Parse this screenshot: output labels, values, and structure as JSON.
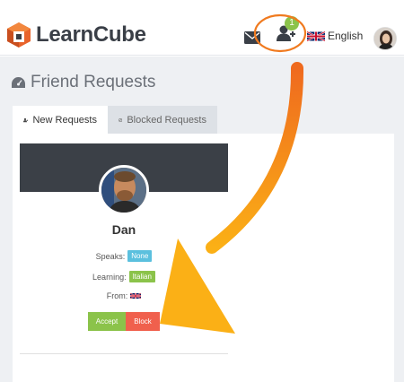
{
  "header": {
    "brand": "LearnCube",
    "friend_badge": "1",
    "language": "English",
    "icons": [
      "logo-cube-icon",
      "mail-icon",
      "add-friend-icon",
      "uk-flag-icon"
    ]
  },
  "page": {
    "title": "Friend Requests",
    "title_icon": "dashboard-icon"
  },
  "tabs": [
    {
      "label": "New Requests",
      "icon": "add-user-icon",
      "active": true
    },
    {
      "label": "Blocked Requests",
      "icon": "ban-icon",
      "active": false
    }
  ],
  "request": {
    "name": "Dan",
    "speaks_label": "Speaks:",
    "speaks_value": "None",
    "learning_label": "Learning:",
    "learning_value": "Italian",
    "from_label": "From:",
    "accept_label": "Accept",
    "block_label": "Block"
  },
  "colors": {
    "accent_green": "#8bc34a",
    "info_blue": "#5bc0de",
    "danger_red": "#f0604d",
    "annotation_orange": "#f07a1f",
    "banner_dark": "#3b4047"
  }
}
